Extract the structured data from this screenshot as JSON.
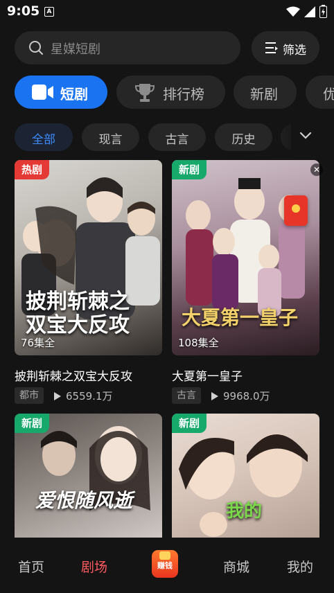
{
  "status": {
    "time": "9:05",
    "a_icon": "A"
  },
  "search": {
    "placeholder": "星媒短剧",
    "icon": "search-icon"
  },
  "filter": {
    "label": "筛选",
    "icon": "filter-icon"
  },
  "main_tabs": [
    {
      "label": "短剧",
      "icon": "video-camera-icon",
      "active": true
    },
    {
      "label": "排行榜",
      "icon": "trophy-icon"
    },
    {
      "label": "新剧"
    },
    {
      "label": "优"
    }
  ],
  "sub_tabs": [
    {
      "label": "全部",
      "active": true
    },
    {
      "label": "现言"
    },
    {
      "label": "古言"
    },
    {
      "label": "历史"
    }
  ],
  "cards": [
    {
      "badge": "热剧",
      "episodes": "76集全",
      "title": "披荆斩棘之双宝大反攻",
      "genre": "都市",
      "plays": "6559.1万",
      "art_title": "披荆斩棘之 双宝大反攻"
    },
    {
      "badge": "新剧",
      "episodes": "108集全",
      "title": "大夏第一皇子",
      "genre": "古言",
      "plays": "9968.0万",
      "art_title": "大夏第一皇子"
    },
    {
      "badge": "新剧",
      "art_title": "爱恨随风逝"
    },
    {
      "badge": "新剧",
      "art_title": "我的"
    }
  ],
  "nav": [
    {
      "label": "首页"
    },
    {
      "label": "剧场",
      "active": true
    },
    {
      "label": "赚钱"
    },
    {
      "label": "商城"
    },
    {
      "label": "我的"
    }
  ],
  "colors": {
    "accent": "#1a73f0",
    "active_nav": "#ff5a5f",
    "hot": "#e53935",
    "new": "#17a86b"
  }
}
